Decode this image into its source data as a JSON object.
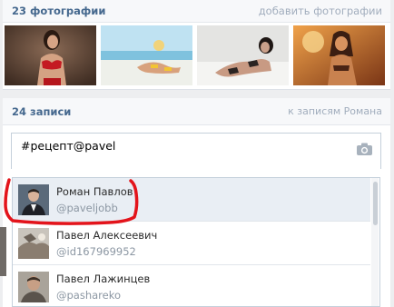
{
  "photos": {
    "title": "23 фотографии",
    "add_link": "добавить фотографии",
    "thumbnails": [
      {
        "name": "photo-1"
      },
      {
        "name": "photo-2"
      },
      {
        "name": "photo-3"
      },
      {
        "name": "photo-4"
      }
    ]
  },
  "wall": {
    "title": "24 записи",
    "to_posts_link": "к записям Романа",
    "input_text": "#рецепт@pavel",
    "camera_icon": "camera-icon"
  },
  "mentions": {
    "items": [
      {
        "name": "Роман Павлов",
        "handle": "@paveljobb",
        "selected": true
      },
      {
        "name": "Павел Алексеевич",
        "handle": "@id167969952",
        "selected": false
      },
      {
        "name": "Павел Лажинцев",
        "handle": "@pashareko",
        "selected": false
      }
    ]
  },
  "colors": {
    "accent": "#45688e",
    "muted_link": "#a1adbd",
    "highlight": "#e3141b",
    "selected_bg": "#e9eef4"
  }
}
